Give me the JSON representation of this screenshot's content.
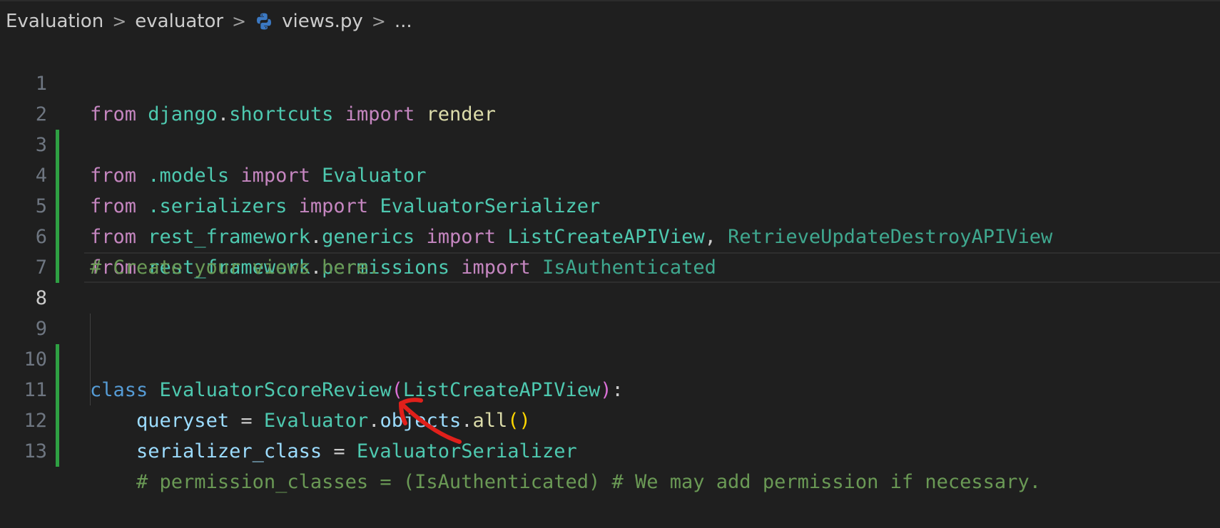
{
  "breadcrumb": {
    "items": [
      "Evaluation",
      "evaluator",
      "views.py",
      "..."
    ],
    "separator": ">"
  },
  "editor": {
    "active_line": 8,
    "lines": [
      {
        "num": "1",
        "modified": false
      },
      {
        "num": "2",
        "modified": true
      },
      {
        "num": "3",
        "modified": true
      },
      {
        "num": "4",
        "modified": true
      },
      {
        "num": "5",
        "modified": true
      },
      {
        "num": "6",
        "modified": true
      },
      {
        "num": "7",
        "modified": false
      },
      {
        "num": "8",
        "modified": false
      },
      {
        "num": "9",
        "modified": true
      },
      {
        "num": "10",
        "modified": true
      },
      {
        "num": "11",
        "modified": true
      },
      {
        "num": "12",
        "modified": true
      },
      {
        "num": "13",
        "modified": false
      }
    ],
    "tokens": {
      "from": "from",
      "import": "import",
      "class": "class",
      "l1_module_a": "django",
      "l1_module_b": "shortcuts",
      "l1_name": "render",
      "l2_module": ".models",
      "l2_name": "Evaluator",
      "l3_module": ".serializers",
      "l3_name": "EvaluatorSerializer",
      "l4_module_a": "rest_framework",
      "l4_module_b": "generics",
      "l4_name_a": "ListCreateAPIView",
      "l4_name_b": "RetrieveUpdateDestroyAPIView",
      "l5_module_a": "rest_framework",
      "l5_module_b": "permissions",
      "l5_name": "IsAuthenticated",
      "l8_comment": "# Create your views here.",
      "l9_class_name": "EvaluatorScoreReview",
      "l9_base": "ListCreateAPIView",
      "l10_var": "queryset",
      "l10_cls": "Evaluator",
      "l10_attr": "objects",
      "l10_fn": "all",
      "l11_var": "serializer_class",
      "l11_cls": "EvaluatorSerializer",
      "l12_comment": "# permission_classes = (IsAuthenticated) # We may add permission if necessary."
    }
  },
  "colors": {
    "background": "#1f1f1f",
    "git_modified": "#2ea043",
    "annotation": "#e0201b"
  },
  "icons": {
    "breadcrumb_file": "python-icon",
    "annotation": "red-arrow-annotation"
  }
}
